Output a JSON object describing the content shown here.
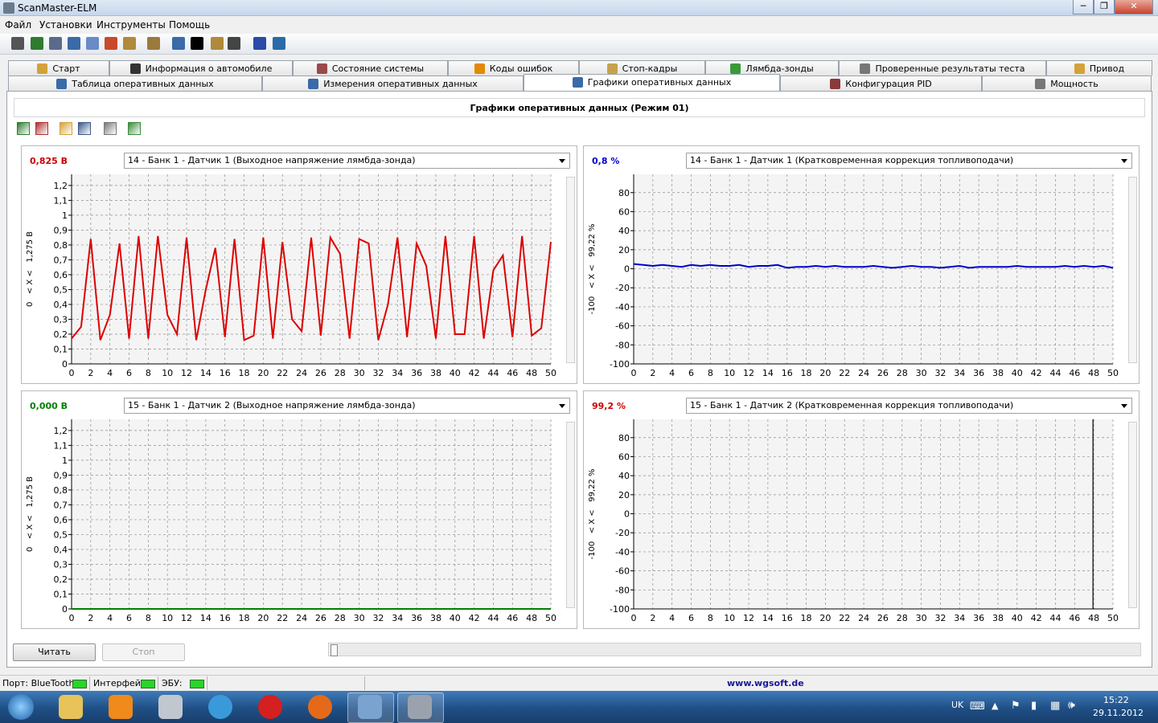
{
  "window": {
    "title": "ScanMaster-ELM",
    "minimize": "─",
    "maximize": "❐",
    "close": "✕"
  },
  "menu": [
    "Файл",
    "Установки",
    "Инструменты",
    "Помощь"
  ],
  "toolbar_icons": [
    "connect-icon",
    "globe-icon",
    "document-icon",
    "table-icon",
    "chart-icon",
    "palette-icon",
    "cup-icon",
    "clipboard-icon",
    "window-icon",
    "terminal-icon",
    "battery-icon",
    "disc-icon",
    "info-icon",
    "book-icon"
  ],
  "tabs_row1": [
    {
      "label": "Старт",
      "icon": "start-icon",
      "color": "#d4a23a"
    },
    {
      "label": "Информация о автомобиле",
      "icon": "info-icon",
      "color": "#333"
    },
    {
      "label": "Состояние системы",
      "icon": "system-icon",
      "color": "#9a4a4a"
    },
    {
      "label": "Коды ошибок",
      "icon": "warning-icon",
      "color": "#e28a00"
    },
    {
      "label": "Стоп-кадры",
      "icon": "freeze-icon",
      "color": "#c6a24e"
    },
    {
      "label": "Лямбда-зонды",
      "icon": "lambda-icon",
      "color": "#3a9a3a"
    },
    {
      "label": "Проверенные результаты теста",
      "icon": "gear-icon",
      "color": "#777"
    },
    {
      "label": "Привод",
      "icon": "drive-icon",
      "color": "#d4a23a"
    }
  ],
  "tabs_row2": [
    {
      "label": "Таблица оперативных данных",
      "icon": "table-icon",
      "color": "#3a6aa8"
    },
    {
      "label": "Измерения оперативных данных",
      "icon": "grid-icon",
      "color": "#3a6aa8"
    },
    {
      "label": "Графики оперативных данных",
      "icon": "chart-icon",
      "color": "#3a6aa8",
      "active": true
    },
    {
      "label": "Конфигурация PID",
      "icon": "config-icon",
      "color": "#8a3a3a"
    },
    {
      "label": "Мощность",
      "icon": "power-icon",
      "color": "#777"
    }
  ],
  "panel_title": "Графики оперативных данных (Режим 01)",
  "graph_toolbar_icons": [
    "add-graph-icon",
    "remove-graph-icon",
    "open-folder-icon",
    "save-icon",
    "print-icon",
    "export-icon"
  ],
  "charts": [
    {
      "value": "0,825 В",
      "value_color": "#cc0000",
      "pid": "14 - Банк 1 - Датчик 1 (Выходное напряжение лямбда-зонда)",
      "range_label": "0   < X <   1,275 В",
      "y_ticks": [
        "0",
        "0,1",
        "0,2",
        "0,3",
        "0,4",
        "0,5",
        "0,6",
        "0,7",
        "0,8",
        "0,9",
        "1",
        "1,1",
        "1,2"
      ],
      "x_ticks": [
        "0",
        "2",
        "4",
        "6",
        "8",
        "10",
        "12",
        "14",
        "16",
        "18",
        "20",
        "22",
        "24",
        "26",
        "28",
        "30",
        "32",
        "34",
        "36",
        "38",
        "40",
        "42",
        "44",
        "46",
        "48",
        "50"
      ]
    },
    {
      "value": "0,8 %",
      "value_color": "#0000cc",
      "pid": "14 - Банк 1 - Датчик 1 (Кратковременная коррекция топливоподачи)",
      "range_label": "-100   < X <   99,22 %",
      "y_ticks": [
        "-100",
        "-80",
        "-60",
        "-40",
        "-20",
        "0",
        "20",
        "40",
        "60",
        "80"
      ],
      "x_ticks": [
        "0",
        "2",
        "4",
        "6",
        "8",
        "10",
        "12",
        "14",
        "16",
        "18",
        "20",
        "22",
        "24",
        "26",
        "28",
        "30",
        "32",
        "34",
        "36",
        "38",
        "40",
        "42",
        "44",
        "46",
        "48",
        "50"
      ]
    },
    {
      "value": "0,000 В",
      "value_color": "#008000",
      "pid": "15 - Банк 1 - Датчик 2 (Выходное напряжение лямбда-зонда)",
      "range_label": "0   < X <   1,275 В",
      "y_ticks": [
        "0",
        "0,1",
        "0,2",
        "0,3",
        "0,4",
        "0,5",
        "0,6",
        "0,7",
        "0,8",
        "0,9",
        "1",
        "1,1",
        "1,2"
      ],
      "x_ticks": [
        "0",
        "2",
        "4",
        "6",
        "8",
        "10",
        "12",
        "14",
        "16",
        "18",
        "20",
        "22",
        "24",
        "26",
        "28",
        "30",
        "32",
        "34",
        "36",
        "38",
        "40",
        "42",
        "44",
        "46",
        "48",
        "50"
      ]
    },
    {
      "value": "99,2 %",
      "value_color": "#cc0000",
      "pid": "15 - Банк 1 - Датчик 2 (Кратковременная коррекция топливоподачи)",
      "range_label": "-100   < X <   99,22 %",
      "y_ticks": [
        "-100",
        "-80",
        "-60",
        "-40",
        "-20",
        "0",
        "20",
        "40",
        "60",
        "80"
      ],
      "x_ticks": [
        "0",
        "2",
        "4",
        "6",
        "8",
        "10",
        "12",
        "14",
        "16",
        "18",
        "20",
        "22",
        "24",
        "26",
        "28",
        "30",
        "32",
        "34",
        "36",
        "38",
        "40",
        "42",
        "44",
        "46",
        "48",
        "50"
      ]
    }
  ],
  "chart_data": [
    {
      "type": "line",
      "series": [
        {
          "color": "#dd0000",
          "x": [
            0,
            1,
            2,
            3,
            4,
            5,
            6,
            7,
            8,
            9,
            10,
            11,
            12,
            13,
            14,
            15,
            16,
            17,
            18,
            19,
            20,
            21,
            22,
            23,
            24,
            25,
            26,
            27,
            28,
            29,
            30,
            31,
            32,
            33,
            34,
            35,
            36,
            37,
            38,
            39,
            40,
            41,
            42,
            43,
            44,
            45,
            46,
            47,
            48,
            49,
            50
          ],
          "values": [
            0.17,
            0.25,
            0.84,
            0.16,
            0.33,
            0.81,
            0.17,
            0.86,
            0.17,
            0.86,
            0.33,
            0.2,
            0.85,
            0.16,
            0.5,
            0.78,
            0.18,
            0.84,
            0.16,
            0.19,
            0.85,
            0.17,
            0.82,
            0.3,
            0.22,
            0.85,
            0.19,
            0.85,
            0.74,
            0.17,
            0.84,
            0.81,
            0.16,
            0.4,
            0.85,
            0.18,
            0.81,
            0.66,
            0.17,
            0.86,
            0.2,
            0.2,
            0.86,
            0.17,
            0.63,
            0.73,
            0.18,
            0.86,
            0.19,
            0.24,
            0.82
          ]
        }
      ],
      "xlim": [
        0,
        50
      ],
      "ylim": [
        0,
        1.275
      ],
      "ylabel": "0   < X <   1,275 В",
      "grid": true
    },
    {
      "type": "line",
      "series": [
        {
          "color": "#0000cc",
          "x": [
            0,
            1,
            2,
            3,
            4,
            5,
            6,
            7,
            8,
            9,
            10,
            11,
            12,
            13,
            14,
            15,
            16,
            17,
            18,
            19,
            20,
            21,
            22,
            23,
            24,
            25,
            26,
            27,
            28,
            29,
            30,
            31,
            32,
            33,
            34,
            35,
            36,
            37,
            38,
            39,
            40,
            41,
            42,
            43,
            44,
            45,
            46,
            47,
            48,
            49,
            50
          ],
          "values": [
            5,
            4,
            3,
            4,
            3,
            2,
            4,
            3,
            4,
            3,
            3,
            4,
            2,
            3,
            3,
            4,
            1,
            2,
            2,
            3,
            2,
            3,
            2,
            2,
            2,
            3,
            2,
            1,
            2,
            3,
            2,
            2,
            1,
            2,
            3,
            1,
            2,
            2,
            2,
            2,
            3,
            2,
            2,
            2,
            2,
            3,
            2,
            3,
            2,
            3,
            1
          ]
        }
      ],
      "xlim": [
        0,
        50
      ],
      "ylim": [
        -100,
        99.22
      ],
      "ylabel": "-100   < X <   99,22 %",
      "grid": true
    },
    {
      "type": "line",
      "series": [
        {
          "color": "#008000",
          "x": [
            0,
            50
          ],
          "values": [
            0,
            0
          ]
        }
      ],
      "xlim": [
        0,
        50
      ],
      "ylim": [
        0,
        1.275
      ],
      "ylabel": "0   < X <   1,275 В",
      "grid": true
    },
    {
      "type": "line",
      "series": [],
      "cursor_x": 48,
      "xlim": [
        0,
        50
      ],
      "ylim": [
        -100,
        99.22
      ],
      "ylabel": "-100   < X <   99,22 %",
      "grid": true
    }
  ],
  "buttons": {
    "read": "Читать",
    "stop": "Стоп"
  },
  "status": {
    "port_label": "Порт: BlueTooth",
    "interface_label": "Интерфейс",
    "ecu_label": "ЭБУ:",
    "led_color": "#27d627",
    "website": "www.wgsoft.de"
  },
  "taskbar": {
    "apps": [
      "start-orb-icon",
      "explorer-icon",
      "vlc-icon",
      "media-classic-icon",
      "ie-icon",
      "opera-icon",
      "firefox-icon",
      "control-panel-icon",
      "scanmaster-icon"
    ],
    "lang": "UK",
    "time": "15:22",
    "date": "29.11.2012"
  }
}
